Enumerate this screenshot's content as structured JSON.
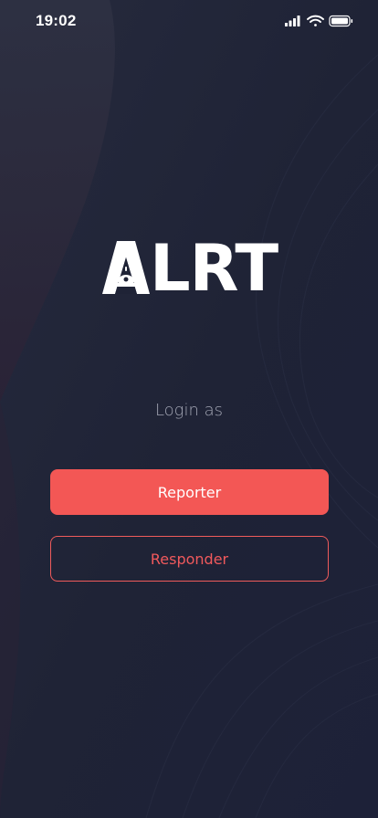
{
  "status_bar": {
    "time": "19:02",
    "icons": [
      "signal-icon",
      "wifi-icon",
      "battery-icon"
    ]
  },
  "logo": {
    "text_start": "A",
    "text_rest": "LRT"
  },
  "login": {
    "label": "Login as",
    "reporter_button": "Reporter",
    "responder_button": "Responder"
  },
  "colors": {
    "background": "#1f2336",
    "accent": "#f35755",
    "text_muted": "#a2a5b3",
    "white": "#ffffff"
  }
}
